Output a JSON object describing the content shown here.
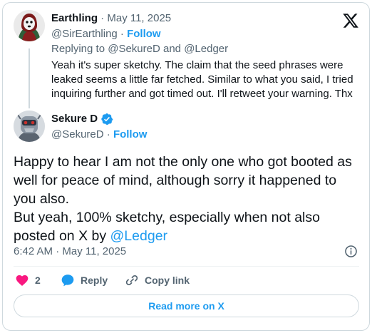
{
  "reply_tweet": {
    "author_name": "Earthling",
    "date_sep": " · ",
    "date": "May 11, 2025",
    "handle": "@SirEarthling",
    "follow_sep": " · ",
    "follow_label": "Follow",
    "replying_to_prefix": "Replying to ",
    "replying_to_1": "@SekureD",
    "replying_and": " and ",
    "replying_to_2": "@Ledger",
    "text": "Yeah it's super sketchy. The claim that the seed phrases were leaked seems a little far fetched. Similar to what you said, I tried inquiring further and got timed out. I'll retweet your warning. Thx"
  },
  "main_tweet": {
    "author_name": "Sekure D",
    "handle": "@SekureD",
    "follow_sep": " · ",
    "follow_label": "Follow",
    "text_line1": "Happy to hear I am not the only one who got booted as well for peace of mind, although sorry it happened to you also.",
    "text_line2_prefix": "But yeah, 100% sketchy, especially when not also posted on X by ",
    "text_mention": "@Ledger",
    "timestamp": "6:42 AM · May 11, 2025"
  },
  "actions": {
    "like_count": "2",
    "reply_label": "Reply",
    "copy_link_label": "Copy link"
  },
  "read_more_label": "Read more on X",
  "colors": {
    "accent": "#1d9bf0",
    "like": "#f91880",
    "muted": "#536471",
    "border": "#cfd9de"
  },
  "icons": {
    "brand": "x-logo-icon",
    "verified": "verified-badge-icon",
    "info": "info-icon",
    "like": "heart-icon",
    "reply": "reply-bubble-icon",
    "copy": "link-icon"
  }
}
